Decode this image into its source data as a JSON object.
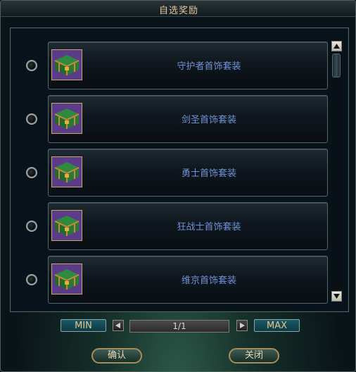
{
  "window": {
    "title": "自选奖励"
  },
  "items": [
    {
      "name": "守护者首饰套装",
      "icon": "treasure-chest-icon"
    },
    {
      "name": "剑圣首饰套装",
      "icon": "treasure-chest-icon"
    },
    {
      "name": "勇士首饰套装",
      "icon": "treasure-chest-icon"
    },
    {
      "name": "狂战士首饰套装",
      "icon": "treasure-chest-icon"
    },
    {
      "name": "维京首饰套装",
      "icon": "treasure-chest-icon"
    }
  ],
  "pager": {
    "min_label": "MIN",
    "max_label": "MAX",
    "page_text": "1/1"
  },
  "actions": {
    "confirm_label": "确认",
    "close_label": "关闭"
  },
  "colors": {
    "item_text": "#6f93d8",
    "button_text": "#e6c58a"
  }
}
